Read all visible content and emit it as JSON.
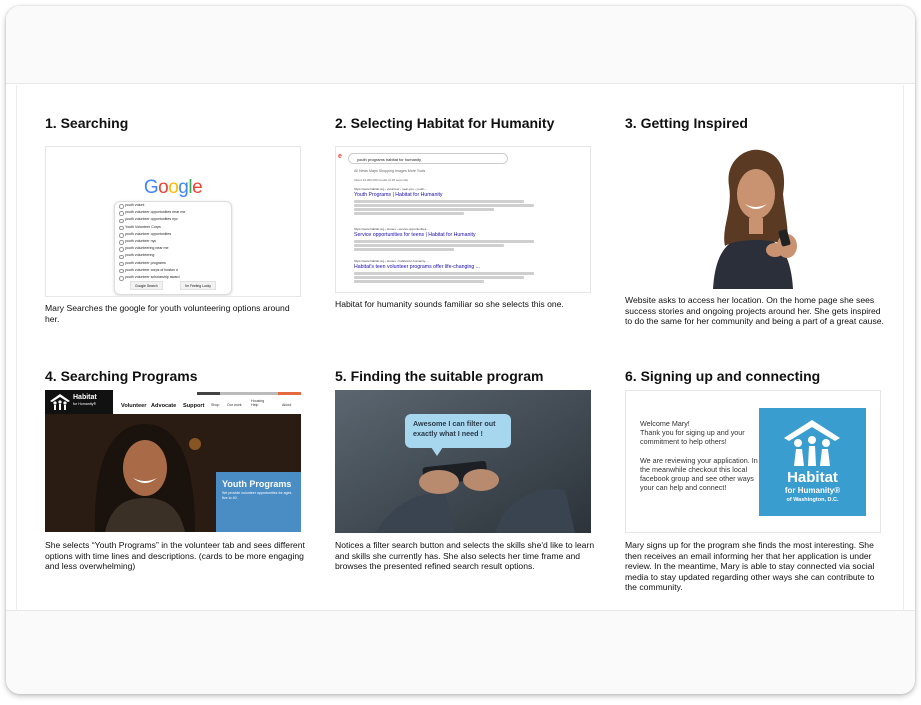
{
  "steps": [
    {
      "title": "1. Searching",
      "caption": "Mary Searches the google for youth volunteering options around her."
    },
    {
      "title": "2. Selecting Habitat for Humanity",
      "caption": "Habitat for humanity sounds familiar so she selects this one."
    },
    {
      "title": "3. Getting Inspired",
      "caption": "Website asks to access her location. On the home page she sees success stories and ongoing projects around her. She gets inspired to do the same for her community and being a part of a great cause."
    },
    {
      "title": "4. Searching Programs",
      "caption": "She selects “Youth Programs” in the volunteer tab and sees different options with time lines and descriptions. (cards to be more engaging and less overwhelming)"
    },
    {
      "title": "5. Finding the suitable program",
      "caption": "Notices a filter search button and selects the skills she'd like to learn and skills she currently has. She also selects her time frame and browses the presented refined search result options."
    },
    {
      "title": "6. Signing up and connecting",
      "caption": "Mary signs up for the program she finds the most interesting. She then receives an email informing her that her application is under review. In the meantime, Mary is able to stay connected via social media to stay updated regarding other ways she can contribute to the community."
    }
  ],
  "google": {
    "logo": "Google",
    "query": "youth volunt",
    "suggestions": [
      "youth volunt",
      "youth volunteer opportunities near me",
      "youth volunteer opportunities nyc",
      "Youth Volunteer Corps",
      "youth volunteer opportunities",
      "youth volunteer nyc",
      "youth volunteering near me",
      "youth volunteering",
      "youth volunteer programs",
      "youth volunteer corps of boston ri",
      "youth volunteer scholarship award"
    ],
    "search_button": "Google Search",
    "lucky_button": "I'm Feeling Lucky"
  },
  "results": {
    "query": "youth programs habitat for humanity",
    "tabs": "All   News   Maps   Shopping   Images   More        Tools",
    "stats": "About 24,300,000 results (0.48 seconds)",
    "items": [
      {
        "url": "https://www.habitat.org › volunteer › near-you › youth-...",
        "title": "Youth Programs | Habitat for Humanity"
      },
      {
        "url": "https://www.habitat.org › stories › service-opportunities-...",
        "title": "Service opportunities for teens | Habitat for Humanity"
      },
      {
        "url": "https://www.habitat.org › stories › habitat-for-humanity-...",
        "title": "Habitat's teen volunteer programs offer life-changing ..."
      }
    ]
  },
  "habitat_site": {
    "logo_main": "Habitat",
    "logo_sub": "for Humanity®",
    "nav": [
      "Volunteer",
      "Advocate",
      "Support"
    ],
    "subnav": [
      "Shop",
      "Our work",
      "Housing Help",
      "About"
    ],
    "panel_title": "Youth Programs",
    "panel_desc": "We provide volunteer opportunities for ages five to 40."
  },
  "filter_bubble": "Awesome I can filter out exactly what I need !",
  "email": {
    "message": "Welcome Mary!\nThank you for siging up and your commitment to help others!\n\nWe are reviewing your application. In the meanwhile checkout this local facebook group and see other ways your can help  and connect!",
    "brand_1": "Habitat",
    "brand_2": "for Humanity®",
    "brand_3": "of Washington, D.C."
  },
  "colors": {
    "habitat_blue": "#3a9dd0",
    "panel_blue": "#4a8cc4",
    "bubble": "#a7d7ef",
    "link": "#1a0dab"
  }
}
